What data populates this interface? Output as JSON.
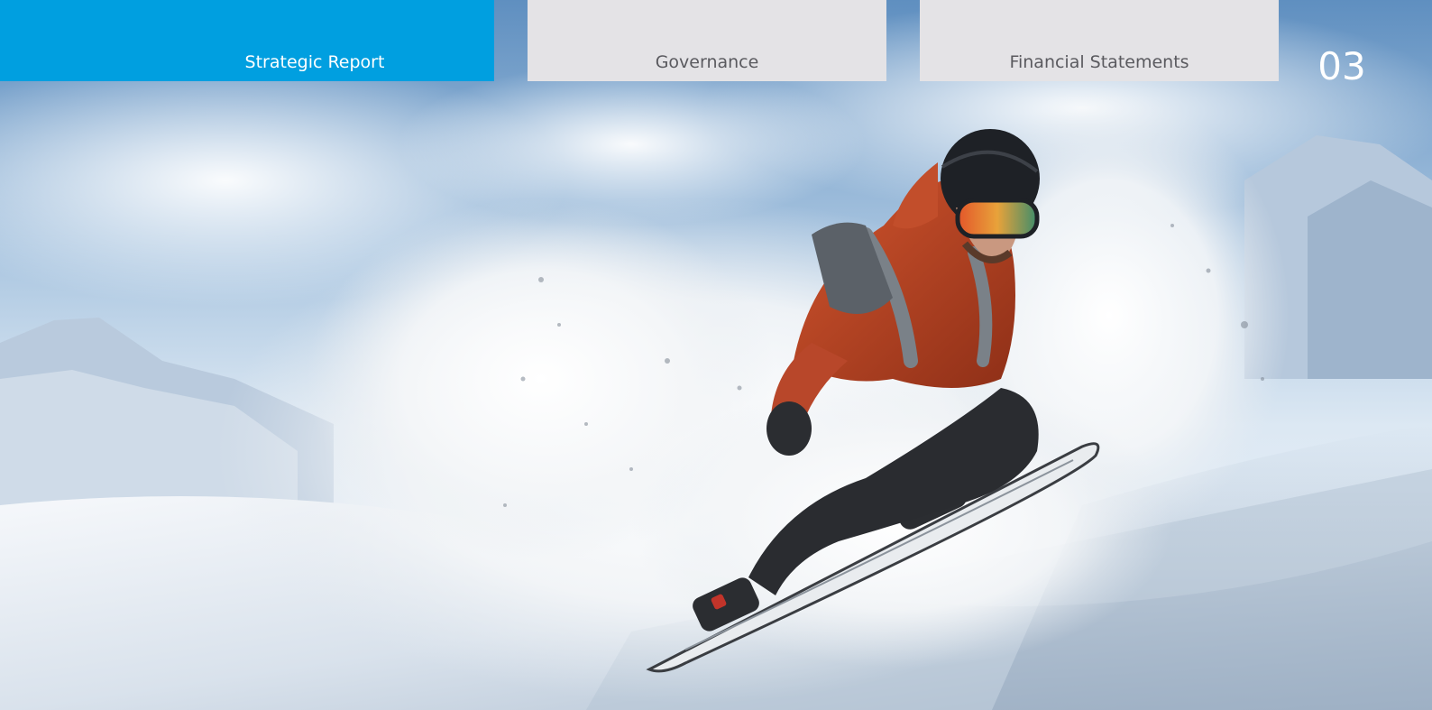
{
  "nav": {
    "tabs": [
      {
        "label": "Strategic Report",
        "active": true
      },
      {
        "label": "Governance",
        "active": false
      },
      {
        "label": "Financial Statements",
        "active": false
      }
    ]
  },
  "page_number": "03",
  "colors": {
    "active_tab": "#009fe0",
    "inactive_tab": "#e4e3e6",
    "inactive_text": "#5a5a5f",
    "active_text": "#ffffff"
  },
  "hero_image": {
    "alt": "Snowboarder carving through powder snow on a mountain slope"
  }
}
